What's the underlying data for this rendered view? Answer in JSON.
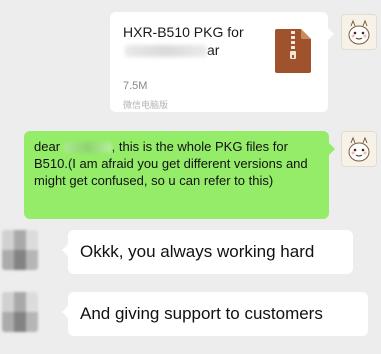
{
  "file_message": {
    "name_line1": "HXR-B510 PKG for",
    "name_line2_suffix": "ar",
    "size": "7.5M",
    "source": "微信电脑版",
    "icon": "zip-archive-icon"
  },
  "text_message": {
    "greeting": "dear",
    "body": ", this is the whole PKG files for B510.(I am afraid you get different versions and might get confused, so u can refer to this)"
  },
  "replies": [
    {
      "text": "Okkk, you always working hard"
    },
    {
      "text": "And giving support to customers"
    }
  ],
  "colors": {
    "chat_background": "#ededed",
    "sent_bubble": "#95ec69",
    "received_bubble": "#ffffff",
    "zip_icon": "#a0522d"
  }
}
